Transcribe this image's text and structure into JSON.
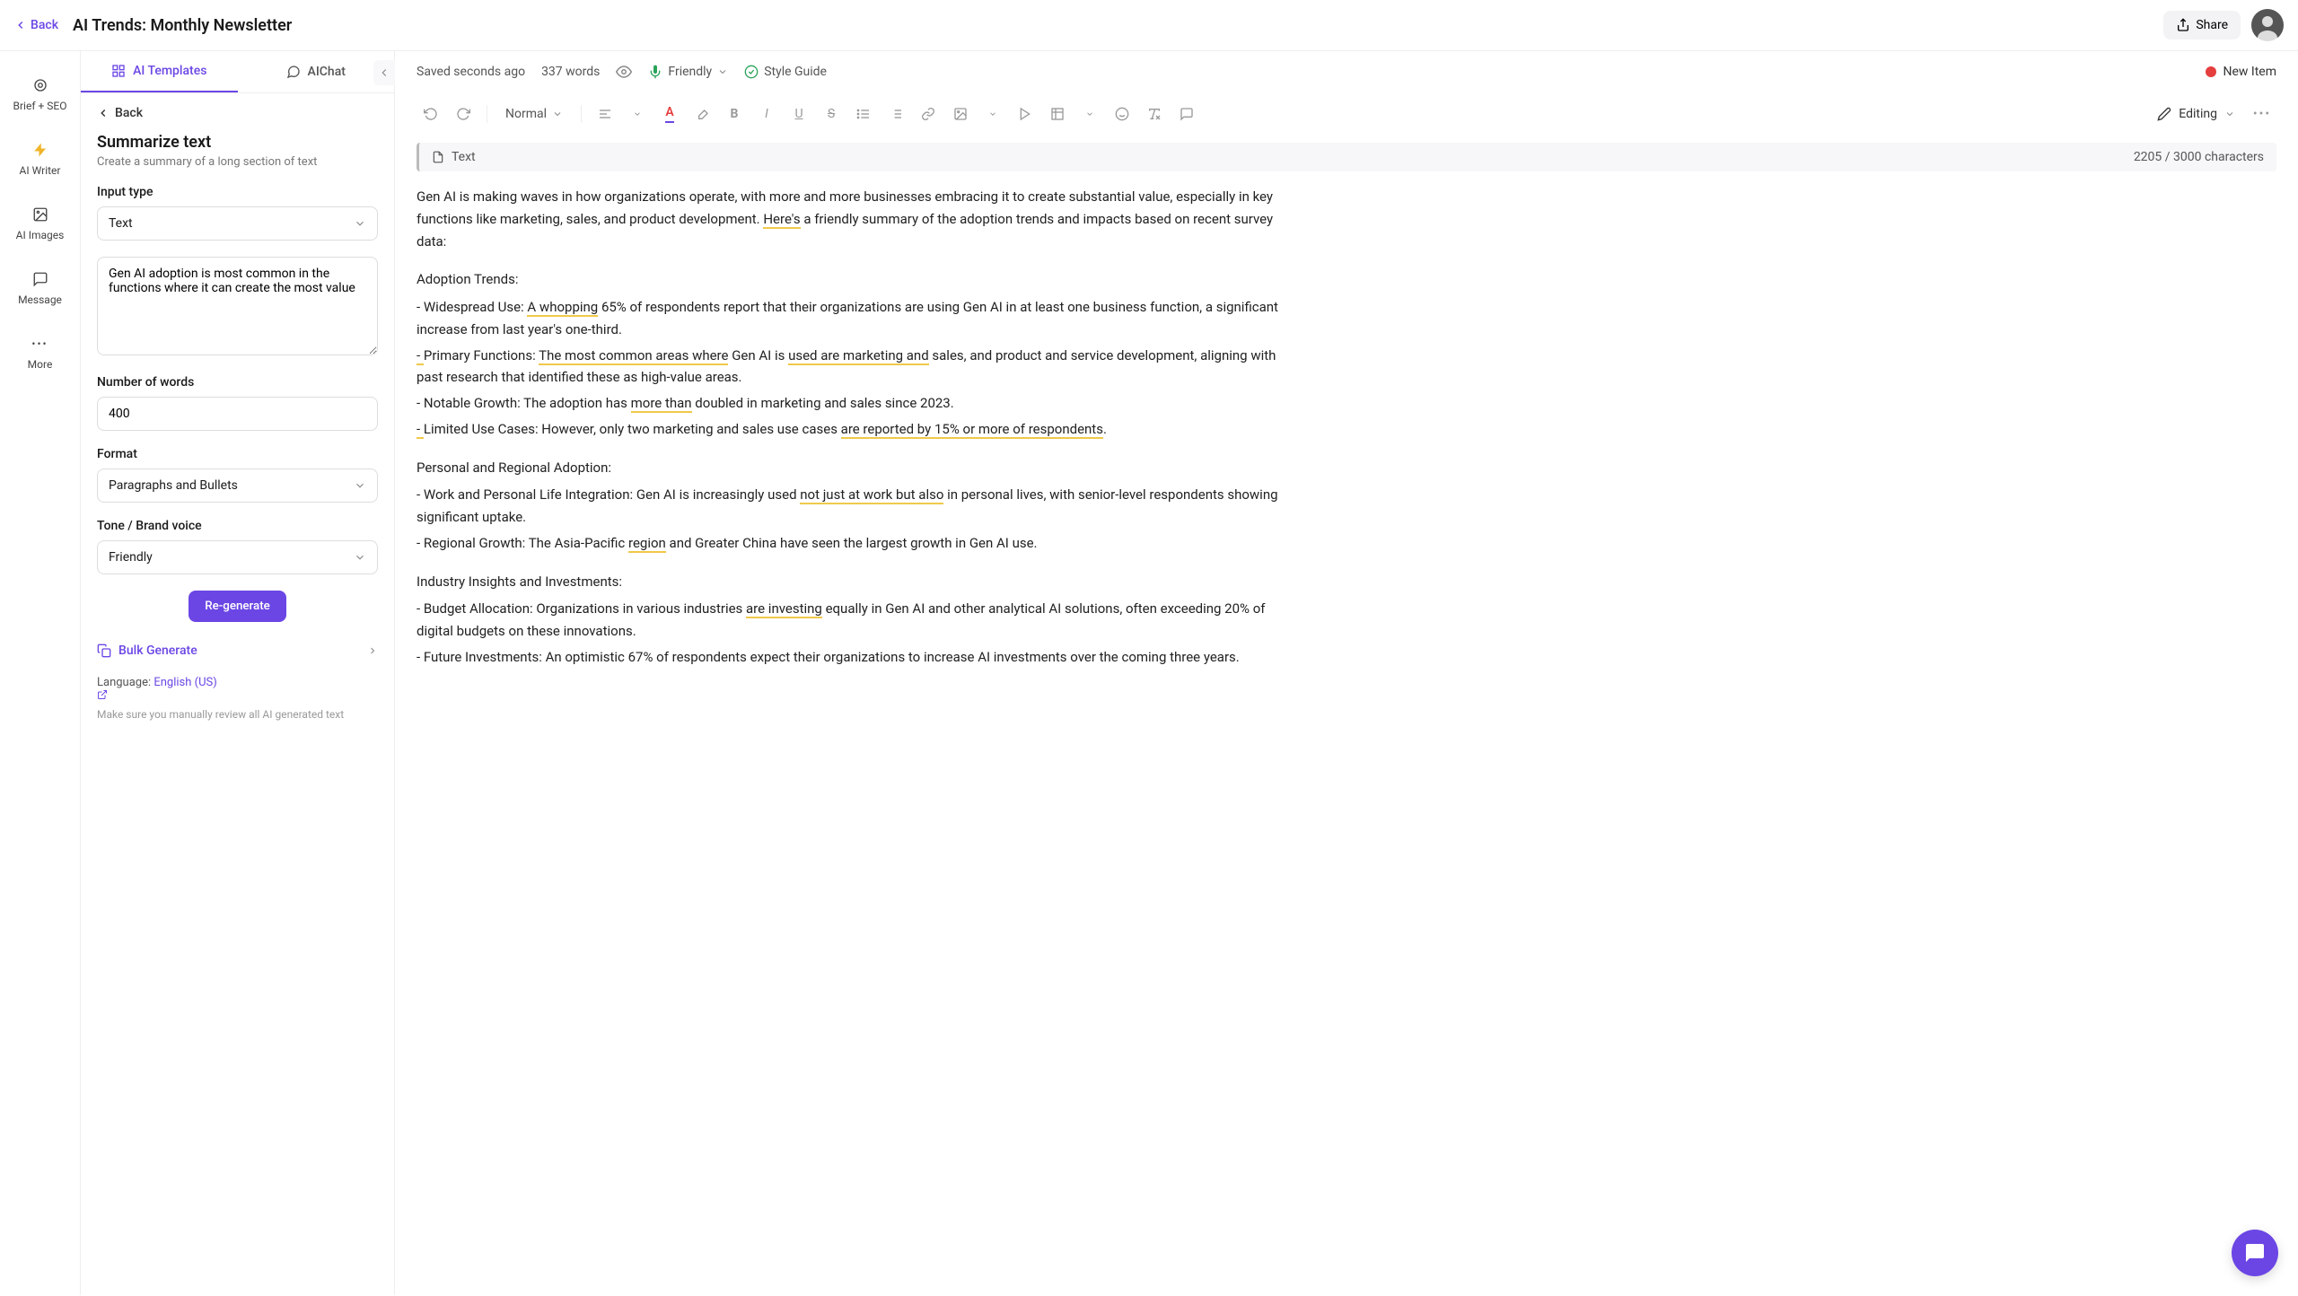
{
  "topbar": {
    "back": "Back",
    "title": "AI Trends: Monthly Newsletter",
    "share": "Share"
  },
  "rail": {
    "brief": "Brief + SEO",
    "writer": "AI Writer",
    "images": "AI Images",
    "message": "Message",
    "more": "More"
  },
  "tabs": {
    "templates": "AI Templates",
    "aichat": "AIChat"
  },
  "panel": {
    "back": "Back",
    "title": "Summarize text",
    "subtitle": "Create a summary of a long section of text",
    "input_type_label": "Input type",
    "input_type_value": "Text",
    "input_text": "Gen AI adoption is most common in the functions where it can create the most value",
    "num_words_label": "Number of words",
    "num_words_value": "400",
    "format_label": "Format",
    "format_value": "Paragraphs and Bullets",
    "tone_label": "Tone / Brand voice",
    "tone_value": "Friendly",
    "regenerate": "Re-generate",
    "bulk": "Bulk Generate",
    "language_label": "Language: ",
    "language_value": "English (US)",
    "note": "Make sure you manually review all AI generated text"
  },
  "editor_top": {
    "saved": "Saved seconds ago",
    "words": "337 words",
    "friendly": "Friendly",
    "style_guide": "Style Guide",
    "new_item": "New Item"
  },
  "toolbar": {
    "normal": "Normal",
    "editing": "Editing"
  },
  "text_chip": {
    "label": "Text",
    "chars": "2205 / 3000 characters"
  },
  "body": {
    "p1a": "Gen AI is making waves in how organizations operate, with more and more businesses embracing it to create substantial value, especially in key functions like marketing, sales, and product development. ",
    "p1b": "Here's",
    "p1c": " a friendly summary of the adoption trends and impacts based on recent survey data:",
    "adoption_title": "Adoption Trends:",
    "wu_a": "- Widespread Use: ",
    "wu_b": "A whopping",
    "wu_c": " 65% of respondents report that their organizations are using Gen AI in at least one business function, a significant increase from last year's one-third.",
    "pf_a": "- ",
    "pf_b": "Primary Functions: ",
    "pf_c": "The most common areas where",
    "pf_d": " Gen AI is ",
    "pf_e": "used are marketing and",
    "pf_f": " sales, and product and service development, aligning with past research that identified these as high-value areas.",
    "ng_a": "- Notable Growth: The adoption has ",
    "ng_b": "more than",
    "ng_c": " doubled in marketing and sales since 2023.",
    "lu_a": "- ",
    "lu_b": "Limited Use Cases: However, only two marketing and sales use cases ",
    "lu_c": "are reported by 15% or more of respondents",
    "lu_d": ".",
    "pra_title": "Personal and Regional Adoption:",
    "wp_a": "- Work and Personal Life Integration: Gen AI is increasingly used ",
    "wp_b": "not just at work but also",
    "wp_c": " in personal lives, with senior-level respondents showing significant uptake.",
    "rg_a": "- Regional Growth: The Asia-Pacific ",
    "rg_b": "region",
    "rg_c": " and Greater China have seen the largest growth in Gen AI use.",
    "ind_title": "Industry Insights and Investments:",
    "ba_a": "- Budget Allocation: Organizations in various industries ",
    "ba_b": "are investing",
    "ba_c": " equally in Gen AI and other analytical AI solutions, often exceeding 20% of digital budgets on these innovations.",
    "fi": "- Future Investments: An optimistic 67% of respondents expect their organizations to increase AI investments over the coming three years."
  }
}
